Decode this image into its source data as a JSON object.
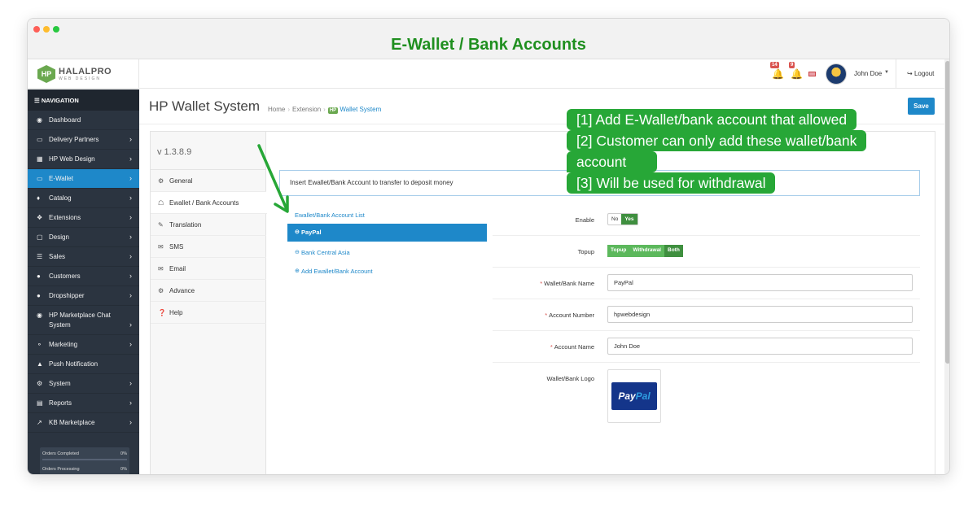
{
  "window": {
    "title": "E-Wallet / Bank Accounts"
  },
  "header": {
    "logo_mark": "HP",
    "logo_text": "HALALPRO",
    "logo_sub": "WEB DESIGN",
    "notifications": [
      {
        "count": "14"
      },
      {
        "count": "9"
      }
    ],
    "user_name": "John Doe",
    "logout_label": "Logout"
  },
  "sidebar": {
    "title": "NAVIGATION",
    "items": [
      {
        "icon": "dashboard-icon",
        "label": "Dashboard",
        "has_children": false
      },
      {
        "icon": "credit-card-icon",
        "label": "Delivery Partners",
        "has_children": true
      },
      {
        "icon": "windows-icon",
        "label": "HP Web Design",
        "has_children": true
      },
      {
        "icon": "credit-card-icon",
        "label": "E-Wallet",
        "has_children": true,
        "active": true
      },
      {
        "icon": "tags-icon",
        "label": "Catalog",
        "has_children": true
      },
      {
        "icon": "puzzle-icon",
        "label": "Extensions",
        "has_children": true
      },
      {
        "icon": "desktop-icon",
        "label": "Design",
        "has_children": true
      },
      {
        "icon": "cart-icon",
        "label": "Sales",
        "has_children": true
      },
      {
        "icon": "user-icon",
        "label": "Customers",
        "has_children": true
      },
      {
        "icon": "users-icon",
        "label": "Dropshipper",
        "has_children": true
      },
      {
        "icon": "chat-icon",
        "label": "HP Marketplace Chat System",
        "has_children": true
      },
      {
        "icon": "share-icon",
        "label": "Marketing",
        "has_children": true
      },
      {
        "icon": "bell-icon",
        "label": "Push Notification",
        "has_children": false
      },
      {
        "icon": "cog-icon",
        "label": "System",
        "has_children": true
      },
      {
        "icon": "bar-chart-icon",
        "label": "Reports",
        "has_children": true
      },
      {
        "icon": "line-chart-icon",
        "label": "KB Marketplace",
        "has_children": true
      }
    ],
    "stats": [
      {
        "label": "Orders Completed",
        "value": "0%",
        "fraction": 0
      },
      {
        "label": "Orders Processing",
        "value": "0%",
        "fraction": 0
      }
    ]
  },
  "page": {
    "title": "HP Wallet System",
    "breadcrumb": [
      "Home",
      "Extension"
    ],
    "breadcrumb_current_tag": "HP",
    "breadcrumb_current": "Wallet System",
    "save_label": "Save"
  },
  "tabs": {
    "version": "v 1.3.8.9",
    "items": [
      {
        "icon": "cog-icon",
        "label": "General"
      },
      {
        "icon": "bank-icon",
        "label": "Ewallet / Bank Accounts",
        "active": true
      },
      {
        "icon": "translate-icon",
        "label": "Translation"
      },
      {
        "icon": "envelope-icon",
        "label": "SMS"
      },
      {
        "icon": "envelope-icon",
        "label": "Email"
      },
      {
        "icon": "cogs-icon",
        "label": "Advance"
      },
      {
        "icon": "question-icon",
        "label": "Help"
      }
    ]
  },
  "info_text": "Insert Ewallet/Bank Account to transfer to deposit money",
  "account_list": {
    "title": "Ewallet/Bank Account List",
    "items": [
      {
        "label": "PayPal",
        "active": true
      },
      {
        "label": "Bank Central Asia"
      }
    ],
    "add_label": "Add Ewallet/Bank Account"
  },
  "form": {
    "enable": {
      "label": "Enable",
      "options": [
        "No",
        "Yes"
      ],
      "selected": "Yes"
    },
    "topup": {
      "label": "Topup",
      "options": [
        "Topup",
        "Withdrawal",
        "Both"
      ],
      "selected": "Both"
    },
    "wallet_name": {
      "label": "Wallet/Bank Name",
      "value": "PayPal"
    },
    "account_number": {
      "label": "Account Number",
      "value": "hpwebdesign"
    },
    "account_name": {
      "label": "Account Name",
      "value": "John Doe"
    },
    "logo": {
      "label": "Wallet/Bank Logo",
      "text_a": "Pay",
      "text_b": "Pal"
    }
  },
  "callout": [
    "[1] Add E-Wallet/bank account that allowed",
    "[2] Customer can only add these wallet/bank",
    "account",
    "[3] Will be used for withdrawal"
  ],
  "colors": {
    "accent": "#1e88c9",
    "callout": "#27a737",
    "sidebar": "#2b3440",
    "title": "#1f8f1f"
  }
}
